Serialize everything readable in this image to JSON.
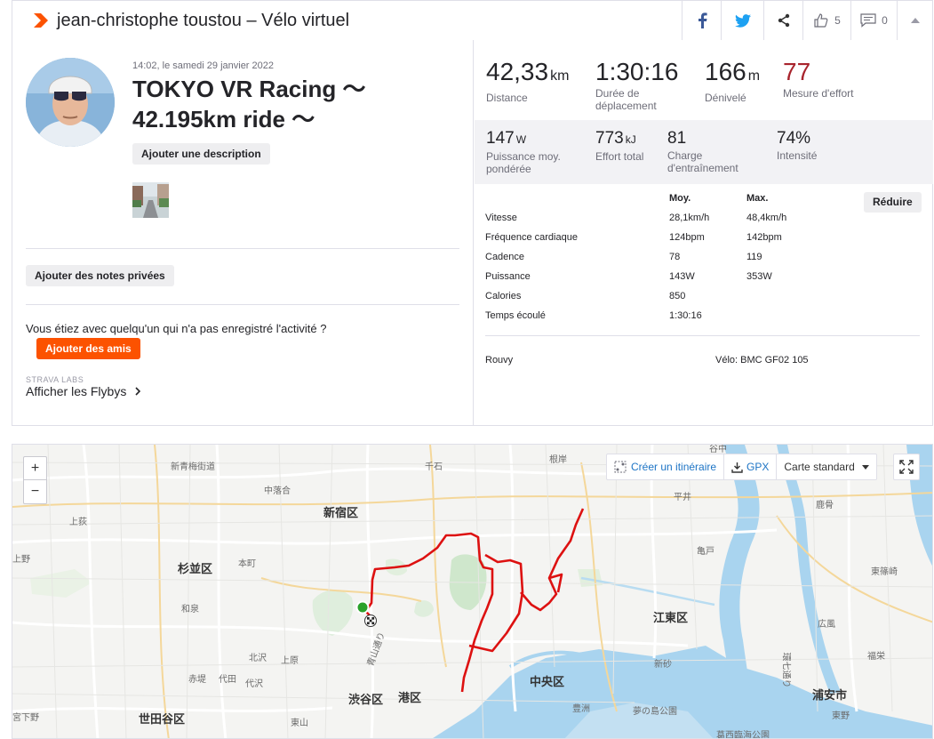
{
  "header": {
    "title": "jean-christophe toustou – Vélo virtuel",
    "kudos_count": "5",
    "comments_count": "0"
  },
  "activity": {
    "datetime": "14:02, le samedi 29 janvier 2022",
    "title": "TOKYO VR Racing ～ 42.195km ride ～",
    "add_description": "Ajouter une description",
    "add_private_notes": "Ajouter des notes privées",
    "with_question": "Vous étiez avec quelqu'un qui n'a pas enregistré l'activité ?",
    "add_friends": "Ajouter des amis",
    "strava_labs": "STRAVA LABS",
    "flybys": "Afficher les Flybys"
  },
  "primary_stats": [
    {
      "value": "42,33",
      "unit": "km",
      "label": "Distance"
    },
    {
      "value": "1:30:16",
      "unit": "",
      "label": "Durée de déplacement"
    },
    {
      "value": "166",
      "unit": "m",
      "label": "Dénivelé"
    },
    {
      "value": "77",
      "unit": "",
      "label": "Mesure d'effort"
    }
  ],
  "secondary_stats": [
    {
      "value": "147",
      "unit": "W",
      "label": "Puissance moy. pondérée"
    },
    {
      "value": "773",
      "unit": "kJ",
      "label": "Effort total"
    },
    {
      "value": "81",
      "unit": "",
      "label": "Charge d'entraînement"
    },
    {
      "value": "74%",
      "unit": "",
      "label": "Intensité"
    }
  ],
  "more_stats": {
    "col_avg": "Moy.",
    "col_max": "Max.",
    "reduce": "Réduire",
    "rows": [
      {
        "label": "Vitesse",
        "avg": "28,1km/h",
        "max": "48,4km/h"
      },
      {
        "label": "Fréquence cardiaque",
        "avg": "124bpm",
        "max": "142bpm"
      },
      {
        "label": "Cadence",
        "avg": "78",
        "max": "119"
      },
      {
        "label": "Puissance",
        "avg": "143W",
        "max": "353W"
      },
      {
        "label": "Calories",
        "avg": "850",
        "max": ""
      },
      {
        "label": "Temps écoulé",
        "avg": "1:30:16",
        "max": ""
      }
    ],
    "device": "Rouvy",
    "bike": "Vélo: BMC GF02 105"
  },
  "map": {
    "zoom_in": "+",
    "zoom_out": "−",
    "create_route": "Créer un itinéraire",
    "gpx": "GPX",
    "map_type": "Carte standard",
    "labels": [
      "新青梅街道",
      "千石",
      "根岸",
      "上荻",
      "中落合",
      "新宿区",
      "平井",
      "鹿骨",
      "杉並区",
      "本町",
      "亀戸",
      "東篠崎",
      "和泉",
      "江東区",
      "広風",
      "北沢",
      "上原",
      "青山通り",
      "新砂",
      "福栄",
      "赤堤",
      "代田",
      "代沢",
      "環七通り",
      "渋谷区",
      "港区",
      "中央区",
      "浦安市",
      "世田谷区",
      "東山",
      "豊洲",
      "夢の島公園",
      "東野",
      "葛西臨海公園",
      "宮下野",
      "上野",
      "谷中"
    ]
  }
}
